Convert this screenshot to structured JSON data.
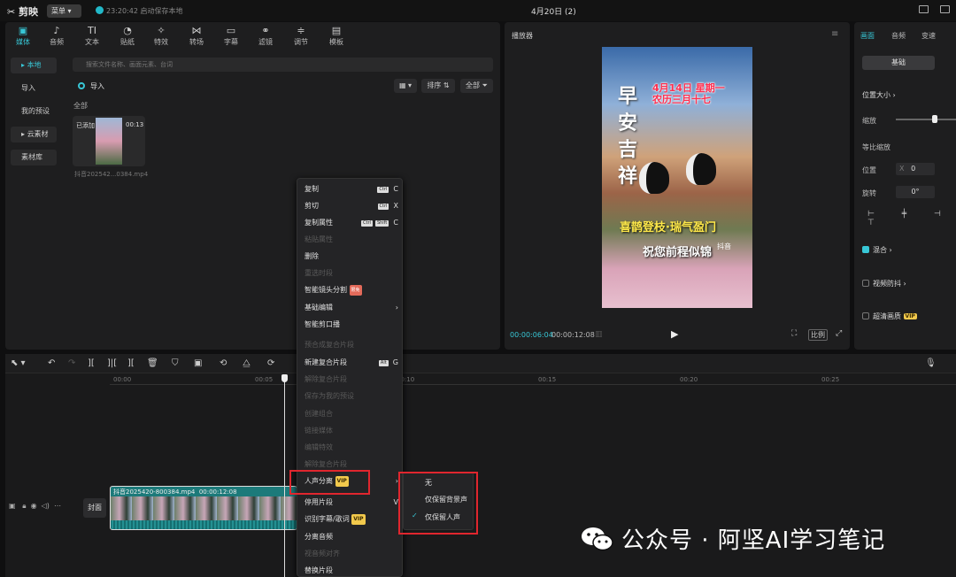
{
  "topbar": {
    "app_name": "剪映",
    "menu_label": "菜单",
    "autosave": "23:20:42 启动保存本地",
    "doc_title": "4月20日 (2)"
  },
  "media_tabs": [
    "媒体",
    "音频",
    "文本",
    "贴纸",
    "特效",
    "转场",
    "字幕",
    "滤镜",
    "调节",
    "模板"
  ],
  "media_sidebar": [
    "本地",
    "导入",
    "我的预设",
    "云素材",
    "素材库"
  ],
  "search_placeholder": "搜索文件名称、画面元素、台词",
  "import_label": "导入",
  "sort_label": "排序",
  "all_filter_label": "全部",
  "all_section": "全部",
  "media_item": {
    "added": "已添加",
    "duration": "00:13",
    "name": "抖音202542...0384.mp4"
  },
  "player": {
    "title": "播放器",
    "time_current": "00:00:06:04",
    "time_total": "00:00:12:08",
    "ratio": "比例"
  },
  "video_text": {
    "date1": "4月14日 星期一",
    "date2": "农历三月十七",
    "big": "早安吉祥",
    "yellow": "喜鹊登枝·瑞气盈门",
    "white": "祝您前程似锦",
    "tiktok": "抖音"
  },
  "props": {
    "tabs": [
      "画面",
      "音频",
      "变速"
    ],
    "basic": "基础",
    "position_size": "位置大小",
    "scale": "缩放",
    "uniform_scale": "等比缩放",
    "position": "位置",
    "pos_x": "0",
    "rotate": "旋转",
    "rotate_val": "0°",
    "blend": "混合",
    "video_stab": "视频防抖",
    "hd": "超清画质",
    "vip": "VIP"
  },
  "timeline": {
    "ticks": [
      "00:00",
      "00:05",
      "00:10",
      "00:15",
      "00:20",
      "00:25"
    ],
    "cover": "封面",
    "clip_name": "抖音2025420-800384.mp4",
    "clip_dur": "00:00:12:08"
  },
  "context_menu": [
    {
      "label": "复制",
      "shortcut": "C",
      "mod": [
        "Ctrl"
      ],
      "disabled": false
    },
    {
      "label": "剪切",
      "shortcut": "X",
      "mod": [
        "Ctrl"
      ],
      "disabled": false
    },
    {
      "label": "复制属性",
      "shortcut": "C",
      "mod": [
        "Ctrl",
        "Shift"
      ],
      "disabled": false
    },
    {
      "label": "粘贴属性",
      "disabled": true
    },
    {
      "label": "删除",
      "disabled": false
    },
    {
      "label": "重选时段",
      "disabled": true
    },
    {
      "label": "智能镜头分割",
      "badge": "限免",
      "disabled": false
    },
    {
      "label": "基础编辑",
      "arrow": true,
      "disabled": false
    },
    {
      "label": "智能剪口播",
      "disabled": false
    },
    {
      "label": "预合成复合片段",
      "disabled": true
    },
    {
      "label": "新建复合片段",
      "shortcut": "G",
      "mod": [
        "Alt"
      ],
      "disabled": false
    },
    {
      "label": "解除复合片段",
      "disabled": true
    },
    {
      "label": "保存为我的预设",
      "disabled": true
    },
    {
      "label": "创建组合",
      "disabled": true
    },
    {
      "label": "链接媒体",
      "disabled": true
    },
    {
      "label": "编辑特效",
      "disabled": true
    },
    {
      "label": "解除复合片段",
      "disabled": true
    },
    {
      "label": "人声分离",
      "badge": "VIP",
      "arrow": true,
      "disabled": false
    },
    {
      "label": "停用片段",
      "shortcut": "V",
      "disabled": false
    },
    {
      "label": "识别字幕/歌词",
      "badge": "VIP",
      "disabled": false
    },
    {
      "label": "分离音频",
      "disabled": false
    },
    {
      "label": "视音频对齐",
      "disabled": true
    },
    {
      "label": "替换片段",
      "disabled": false
    }
  ],
  "submenu": [
    "无",
    "仅保留背景声",
    "仅保留人声"
  ],
  "watermark": "公众号 · 阿坚AI学习笔记",
  "colors": {
    "accent": "#38c7d6",
    "highlight": "#e0262e",
    "vip": "#f2c94c"
  }
}
